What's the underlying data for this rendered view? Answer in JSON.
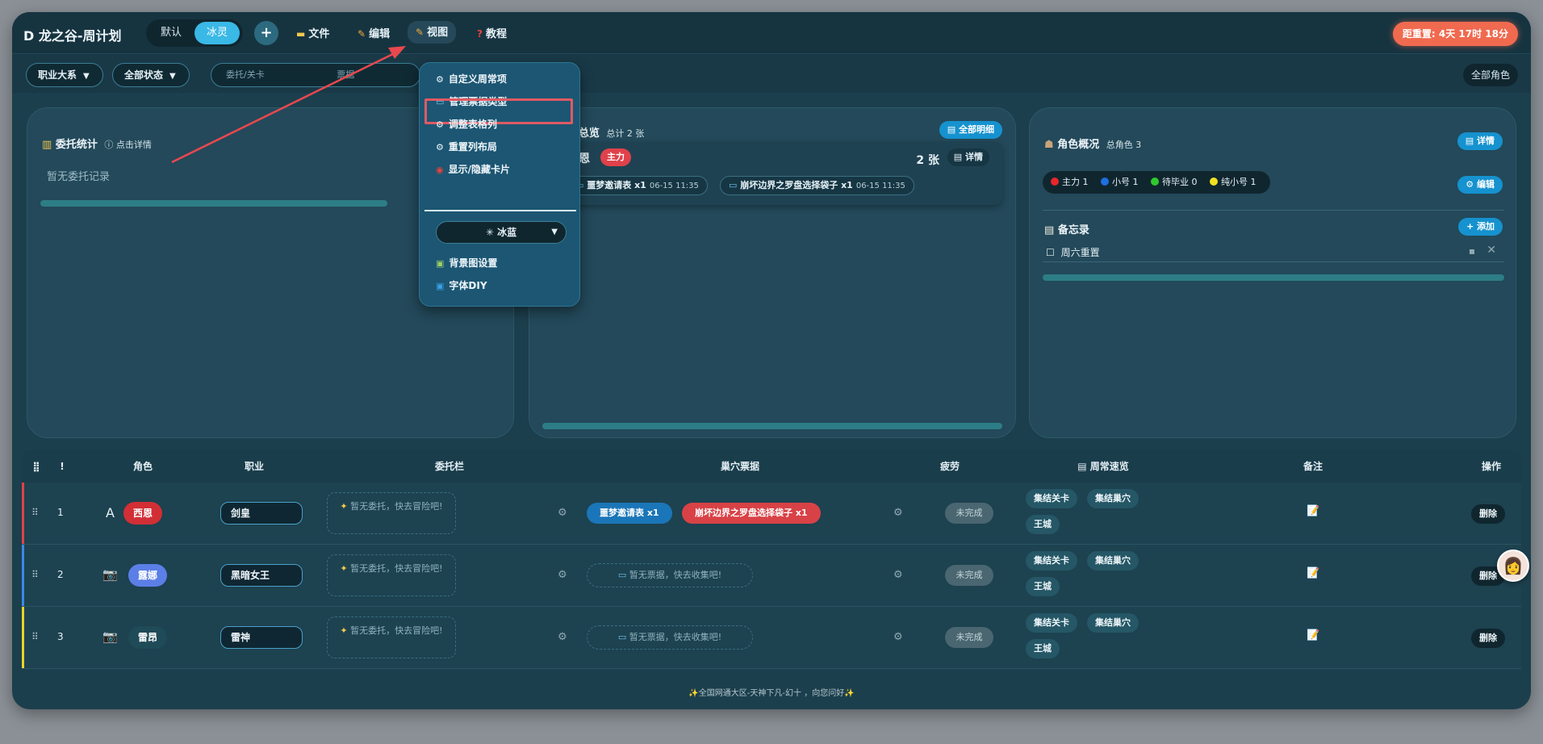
{
  "header": {
    "brand": "D 龙之谷-周计划",
    "theme_default": "默认",
    "theme_ice": "冰灵",
    "add": "+",
    "menu_file": "文件",
    "menu_edit": "编辑",
    "menu_view": "视图",
    "menu_tutorial": "教程",
    "countdown": "距重置: 4天 17时 18分"
  },
  "filters": {
    "job_system": "职业大系",
    "all_status": "全部状态",
    "search_placeholder": "委托/关卡",
    "search_placeholder2": "票据",
    "all_roles": "全部角色"
  },
  "panel_commission": {
    "title": "委托统计",
    "hint": "ⓘ 点击详情",
    "empty": "暂无委托记录"
  },
  "panel_ticket": {
    "title": "票据总览",
    "total": "总计 2 张",
    "all_detail": "全部明细",
    "role_name": "西恩",
    "role_tag": "主力",
    "count": "2 张",
    "detail": "详情",
    "items": [
      {
        "label": "噩梦邀请表 x1",
        "time": "06-15 11:35"
      },
      {
        "label": "崩坏边界之罗盘选择袋子 x1",
        "time": "06-15 11:35"
      }
    ]
  },
  "panel_role": {
    "title": "角色概况",
    "total": "总角色 3",
    "detail": "详情",
    "edit": "编辑",
    "legend": [
      {
        "label": "主力 1",
        "color": "#e8262c"
      },
      {
        "label": "小号 1",
        "color": "#1e6fe0"
      },
      {
        "label": "待毕业 0",
        "color": "#2ec92e"
      },
      {
        "label": "纯小号 1",
        "color": "#f0e020"
      }
    ],
    "memo_title": "备忘录",
    "memo_add": "+ 添加",
    "memo_item": "周六重置"
  },
  "dropdown": {
    "items": [
      "自定义周常项",
      "管理票据类型",
      "调整表格列",
      "重置列布局",
      "显示/隐藏卡片"
    ],
    "theme_select": "冰蓝",
    "bg_settings": "背景图设置",
    "font_diy": "字体DIY"
  },
  "table": {
    "headers": [
      "!",
      "角色",
      "职业",
      "委托栏",
      "巢穴票据",
      "疲劳",
      "周常速览",
      "备注",
      "操作"
    ],
    "rows": [
      {
        "index": "1",
        "icon": "A",
        "role": "西恩",
        "role_color": "#d12f35",
        "strip": "#e0414b",
        "job": "剑皇",
        "commission": "暂无委托，快去冒险吧!",
        "tickets": [
          "噩梦邀请表 x1",
          "崩坏边界之罗盘选择袋子 x1"
        ],
        "ticket_empty": "",
        "fatigue": "未完成",
        "weekly": [
          "集结关卡",
          "集结巢穴",
          "王城"
        ],
        "action": "删除"
      },
      {
        "index": "2",
        "icon": "📷",
        "role": "露娜",
        "role_color": "#5b7fe6",
        "strip": "#3a8ae6",
        "job": "黑暗女王",
        "commission": "暂无委托，快去冒险吧!",
        "tickets": [],
        "ticket_empty": "暂无票据，快去收集吧!",
        "fatigue": "未完成",
        "weekly": [
          "集结关卡",
          "集结巢穴",
          "王城"
        ],
        "action": "删除"
      },
      {
        "index": "3",
        "icon": "📷",
        "role": "雷昂",
        "role_color": "#1f4a58",
        "strip": "#e8d42a",
        "job": "雷神",
        "commission": "暂无委托，快去冒险吧!",
        "tickets": [],
        "ticket_empty": "暂无票据，快去收集吧!",
        "fatigue": "未完成",
        "weekly": [
          "集结关卡",
          "集结巢穴",
          "王城"
        ],
        "action": "删除"
      }
    ]
  },
  "footer": "✨全国网通大区-天神下凡-幻十 ，向您问好✨"
}
